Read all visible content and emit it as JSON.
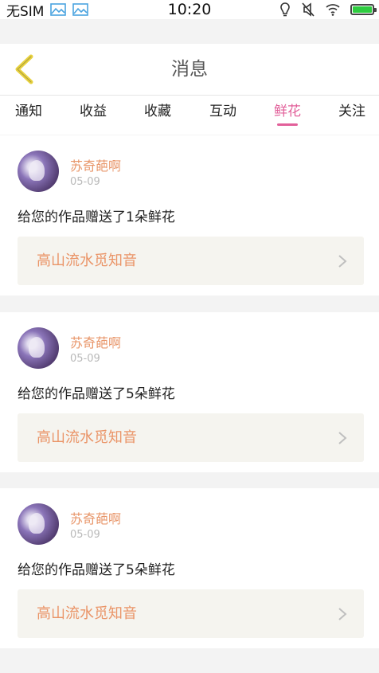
{
  "status_bar": {
    "carrier": "无SIM",
    "time": "10:20"
  },
  "header": {
    "title": "消息"
  },
  "tabs": [
    {
      "label": "通知",
      "active": false
    },
    {
      "label": "收益",
      "active": false
    },
    {
      "label": "收藏",
      "active": false
    },
    {
      "label": "互动",
      "active": false
    },
    {
      "label": "鲜花",
      "active": true
    },
    {
      "label": "关注",
      "active": false
    }
  ],
  "messages": [
    {
      "username": "苏奇葩啊",
      "date": "05-09",
      "text": "给您的作品赠送了1朵鲜花",
      "work_title": "高山流水觅知音"
    },
    {
      "username": "苏奇葩啊",
      "date": "05-09",
      "text": "给您的作品赠送了5朵鲜花",
      "work_title": "高山流水觅知音"
    },
    {
      "username": "苏奇葩啊",
      "date": "05-09",
      "text": "给您的作品赠送了5朵鲜花",
      "work_title": "高山流水觅知音"
    }
  ],
  "colors": {
    "accent": "#e2609a",
    "username": "#e8966a",
    "work_title": "#ea9467",
    "back_arrow": "#e8d23f"
  },
  "icons": [
    "image-icon",
    "image-icon",
    "location-icon",
    "mute-icon",
    "wifi-icon",
    "battery-icon",
    "back-icon",
    "chevron-right-icon"
  ]
}
